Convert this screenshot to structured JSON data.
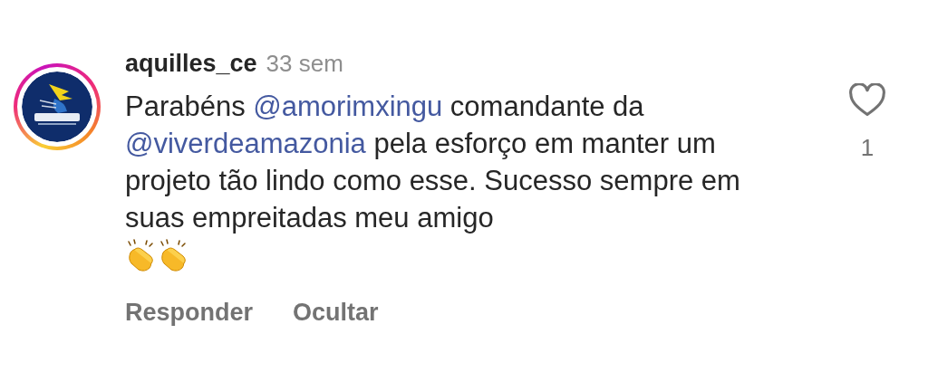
{
  "comment": {
    "username": "aquilles_ce",
    "time": "33 sem",
    "segments": [
      {
        "kind": "text",
        "text": "Parabéns "
      },
      {
        "kind": "mention",
        "text": "@amorimxingu"
      },
      {
        "kind": "text",
        "text": " comandante da "
      },
      {
        "kind": "mention",
        "text": "@viverdeamazonia"
      },
      {
        "kind": "text",
        "text": " pela esforço em manter um projeto tão lindo como esse. Sucesso sempre em suas empreitadas meu amigo"
      }
    ],
    "emojis": [
      {
        "kind": "clap"
      },
      {
        "kind": "clap"
      }
    ],
    "like_count": "1",
    "liked": false,
    "actions": [
      "Responder",
      "Ocultar"
    ]
  }
}
